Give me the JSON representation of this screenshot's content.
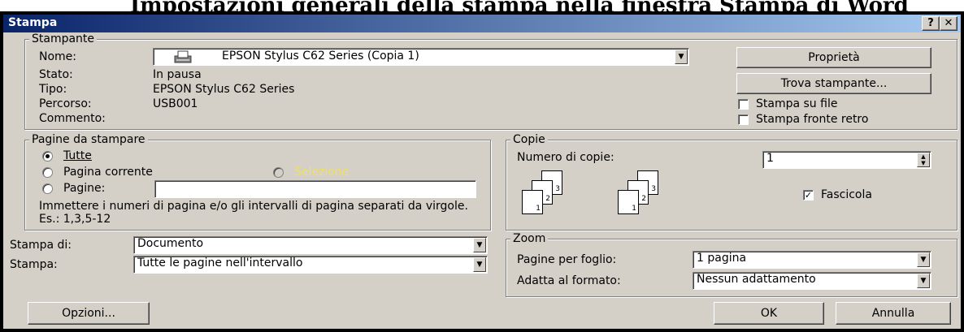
{
  "caption": "Impostazioni generali della stampa nella finestra Stampa di Word",
  "dialog": {
    "title": "Stampa",
    "help_label": "?",
    "close_label": "✕"
  },
  "printer": {
    "legend": "Stampante",
    "name_label": "Nome:",
    "name_value": "EPSON Stylus C62 Series (Copia 1)",
    "status_label": "Stato:",
    "status_value": "In pausa",
    "type_label": "Tipo:",
    "type_value": "EPSON Stylus C62 Series",
    "path_label": "Percorso:",
    "path_value": "USB001",
    "comment_label": "Commento:",
    "properties_label": "Proprietà",
    "find_label": "Trova stampante...",
    "print_to_file_label": "Stampa su file",
    "duplex_label": "Stampa fronte retro"
  },
  "pages": {
    "legend": "Pagine da stampare",
    "all_label": "Tutte",
    "current_label": "Pagina corrente",
    "selection_label": "Selezione",
    "pages_label": "Pagine:",
    "pages_value": "",
    "hint": "Immettere i numeri di pagina e/o gli intervalli di pagina separati da virgole. Es.: 1,3,5-12"
  },
  "copies": {
    "legend": "Copie",
    "count_label": "Numero di copie:",
    "count_value": "1",
    "collate_label": "Fascicola",
    "page_numbers": [
      "3",
      "2",
      "1"
    ]
  },
  "print_what": {
    "label": "Stampa di:",
    "value": "Documento"
  },
  "print_range": {
    "label": "Stampa:",
    "value": "Tutte le pagine nell'intervallo"
  },
  "zoom": {
    "legend": "Zoom",
    "per_sheet_label": "Pagine per foglio:",
    "per_sheet_value": "1 pagina",
    "scale_label": "Adatta al formato:",
    "scale_value": "Nessun adattamento"
  },
  "buttons": {
    "options": "Opzioni...",
    "ok": "OK",
    "cancel": "Annulla"
  },
  "icons": {
    "printer": "printer-icon",
    "dropdown": "dropdown-arrow-icon",
    "spin": "spinner-icon"
  }
}
